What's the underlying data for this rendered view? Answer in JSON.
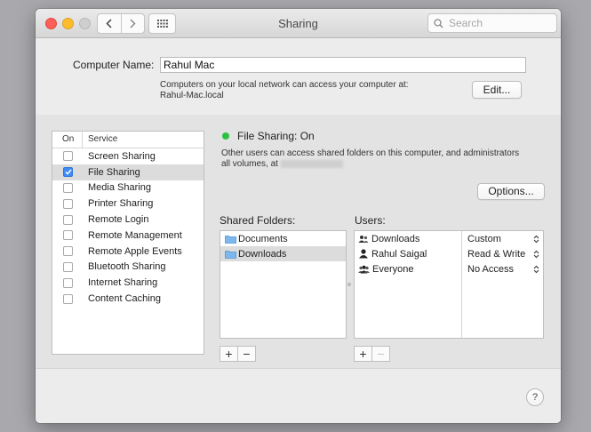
{
  "window": {
    "title": "Sharing"
  },
  "search": {
    "placeholder": "Search"
  },
  "computer": {
    "label": "Computer Name:",
    "name": "Rahul Mac",
    "description": "Computers on your local network can access your computer at:",
    "hostname": "Rahul-Mac.local",
    "edit_label": "Edit..."
  },
  "services": {
    "header_on": "On",
    "header_service": "Service",
    "items": [
      {
        "label": "Screen Sharing",
        "checked": false
      },
      {
        "label": "File Sharing",
        "checked": true
      },
      {
        "label": "Media Sharing",
        "checked": false
      },
      {
        "label": "Printer Sharing",
        "checked": false
      },
      {
        "label": "Remote Login",
        "checked": false
      },
      {
        "label": "Remote Management",
        "checked": false
      },
      {
        "label": "Remote Apple Events",
        "checked": false
      },
      {
        "label": "Bluetooth Sharing",
        "checked": false
      },
      {
        "label": "Internet Sharing",
        "checked": false
      },
      {
        "label": "Content Caching",
        "checked": false
      }
    ]
  },
  "file_sharing": {
    "status": "File Sharing: On",
    "status_color": "#2cc23f",
    "description": "Other users can access shared folders on this computer, and administrators",
    "description_line2": "all volumes, at",
    "options_label": "Options..."
  },
  "shared_folders": {
    "label": "Shared Folders:",
    "items": [
      "Documents",
      "Downloads"
    ]
  },
  "users": {
    "label": "Users:",
    "items": [
      {
        "name": "Downloads",
        "icon": "group-icon",
        "permission": "Custom"
      },
      {
        "name": "Rahul Saigal",
        "icon": "user-icon",
        "permission": "Read & Write"
      },
      {
        "name": "Everyone",
        "icon": "everyone-icon",
        "permission": "No Access"
      }
    ]
  },
  "controls": {
    "add": "+",
    "remove": "−",
    "help": "?"
  }
}
